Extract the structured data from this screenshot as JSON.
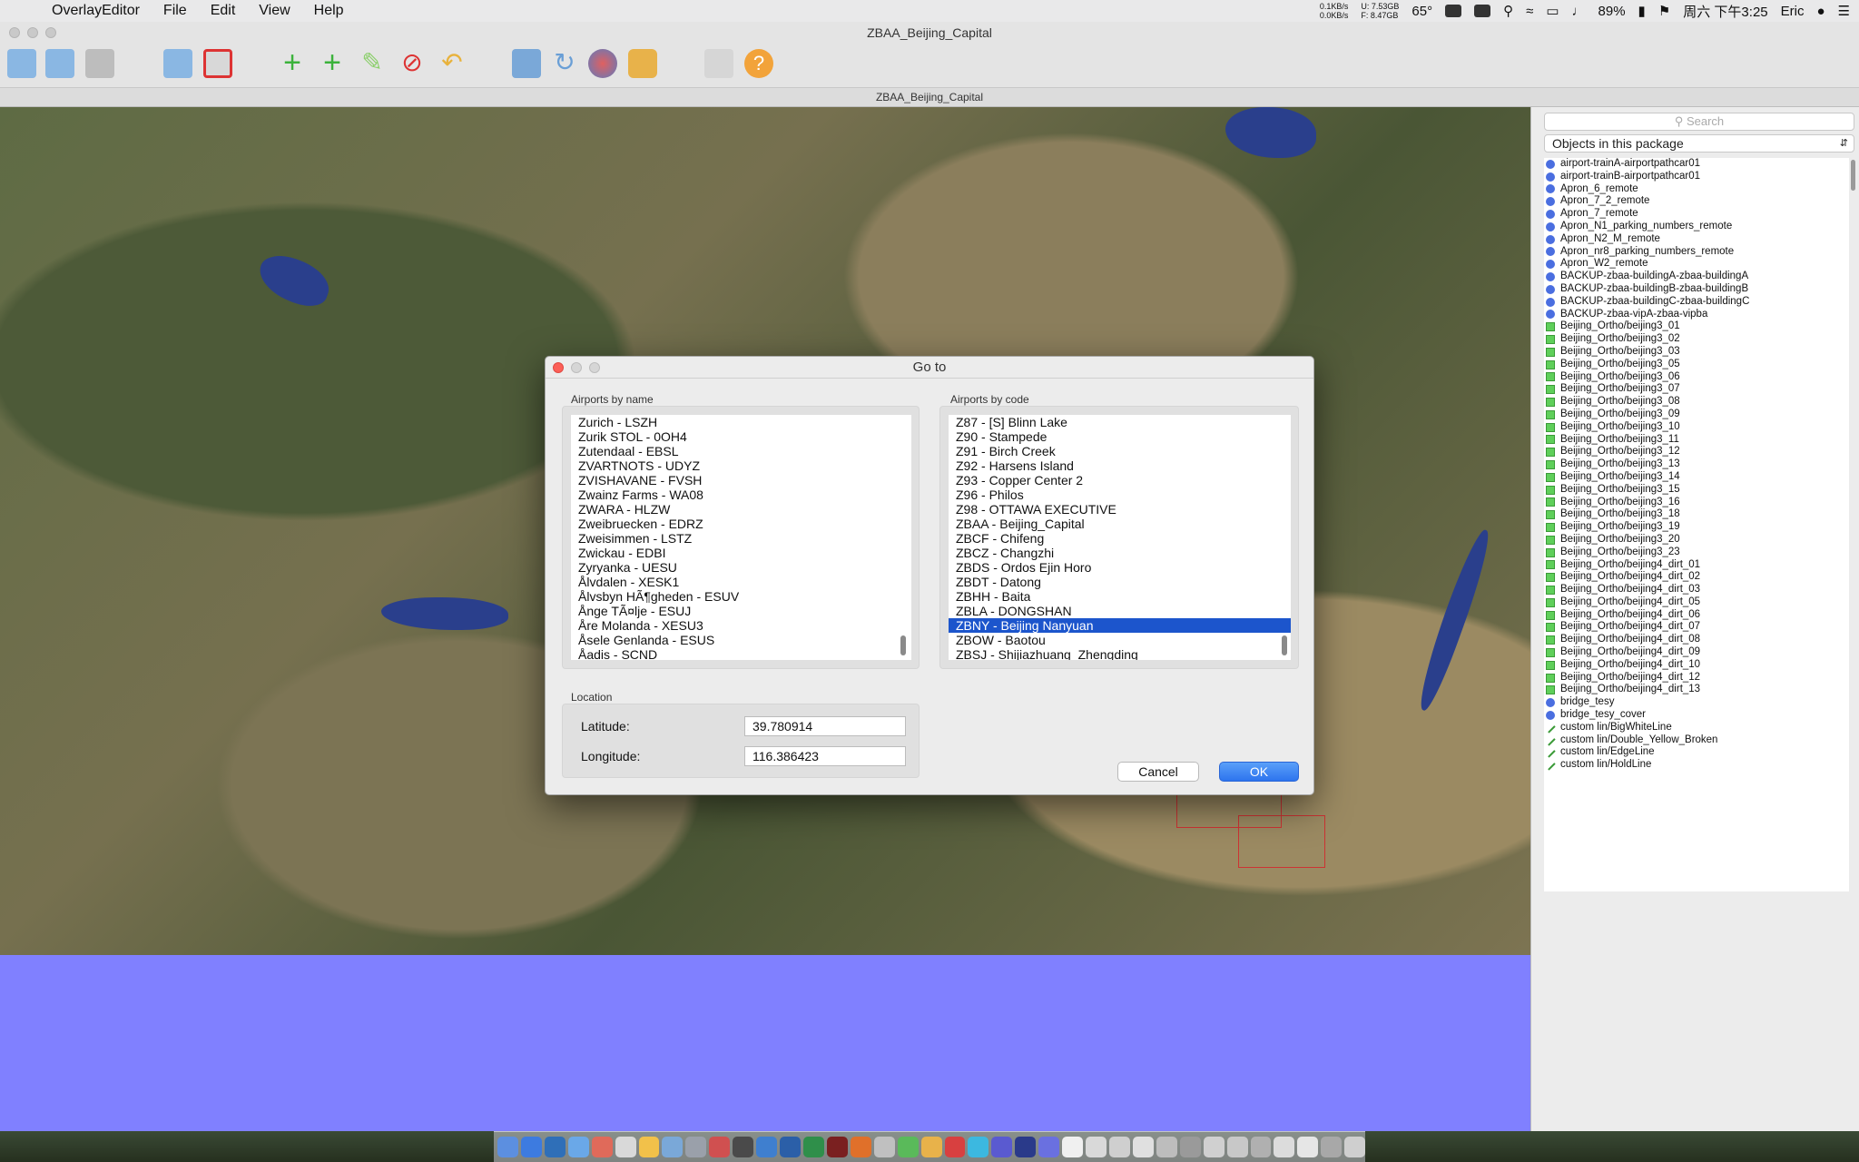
{
  "menubar": {
    "app_name": "OverlayEditor",
    "menus": [
      "File",
      "Edit",
      "View",
      "Help"
    ],
    "status": {
      "net_up": "0.1KB/s",
      "net_down": "0.0KB/s",
      "mem_used": "U: 7.53GB",
      "mem_free": "F: 8.47GB",
      "temp": "65°",
      "battery": "89%",
      "datetime": "周六 下午3:25",
      "user": "Eric"
    }
  },
  "window": {
    "title": "ZBAA_Beijing_Capital",
    "document_title": "ZBAA_Beijing_Capital"
  },
  "panel": {
    "search_placeholder": "Search",
    "filter_selected": "Objects in this package",
    "objects": [
      {
        "name": "airport-trainA-airportpathcar01",
        "kind": "blue"
      },
      {
        "name": "airport-trainB-airportpathcar01",
        "kind": "blue"
      },
      {
        "name": "Apron_6_remote",
        "kind": "blue"
      },
      {
        "name": "Apron_7_2_remote",
        "kind": "blue"
      },
      {
        "name": "Apron_7_remote",
        "kind": "blue"
      },
      {
        "name": "Apron_N1_parking_numbers_remote",
        "kind": "blue"
      },
      {
        "name": "Apron_N2_M_remote",
        "kind": "blue"
      },
      {
        "name": "Apron_nr8_parking_numbers_remote",
        "kind": "blue"
      },
      {
        "name": "Apron_W2_remote",
        "kind": "blue"
      },
      {
        "name": "BACKUP-zbaa-buildingA-zbaa-buildingA",
        "kind": "blue"
      },
      {
        "name": "BACKUP-zbaa-buildingB-zbaa-buildingB",
        "kind": "blue"
      },
      {
        "name": "BACKUP-zbaa-buildingC-zbaa-buildingC",
        "kind": "blue"
      },
      {
        "name": "BACKUP-zbaa-vipA-zbaa-vipba",
        "kind": "blue"
      },
      {
        "name": "Beijing_Ortho/beijing3_01",
        "kind": "green"
      },
      {
        "name": "Beijing_Ortho/beijing3_02",
        "kind": "green"
      },
      {
        "name": "Beijing_Ortho/beijing3_03",
        "kind": "green"
      },
      {
        "name": "Beijing_Ortho/beijing3_05",
        "kind": "green"
      },
      {
        "name": "Beijing_Ortho/beijing3_06",
        "kind": "green"
      },
      {
        "name": "Beijing_Ortho/beijing3_07",
        "kind": "green"
      },
      {
        "name": "Beijing_Ortho/beijing3_08",
        "kind": "green"
      },
      {
        "name": "Beijing_Ortho/beijing3_09",
        "kind": "green"
      },
      {
        "name": "Beijing_Ortho/beijing3_10",
        "kind": "green"
      },
      {
        "name": "Beijing_Ortho/beijing3_11",
        "kind": "green"
      },
      {
        "name": "Beijing_Ortho/beijing3_12",
        "kind": "green"
      },
      {
        "name": "Beijing_Ortho/beijing3_13",
        "kind": "green"
      },
      {
        "name": "Beijing_Ortho/beijing3_14",
        "kind": "green"
      },
      {
        "name": "Beijing_Ortho/beijing3_15",
        "kind": "green"
      },
      {
        "name": "Beijing_Ortho/beijing3_16",
        "kind": "green"
      },
      {
        "name": "Beijing_Ortho/beijing3_18",
        "kind": "green"
      },
      {
        "name": "Beijing_Ortho/beijing3_19",
        "kind": "green"
      },
      {
        "name": "Beijing_Ortho/beijing3_20",
        "kind": "green"
      },
      {
        "name": "Beijing_Ortho/beijing3_23",
        "kind": "green"
      },
      {
        "name": "Beijing_Ortho/beijing4_dirt_01",
        "kind": "green"
      },
      {
        "name": "Beijing_Ortho/beijing4_dirt_02",
        "kind": "green"
      },
      {
        "name": "Beijing_Ortho/beijing4_dirt_03",
        "kind": "green"
      },
      {
        "name": "Beijing_Ortho/beijing4_dirt_05",
        "kind": "green"
      },
      {
        "name": "Beijing_Ortho/beijing4_dirt_06",
        "kind": "green"
      },
      {
        "name": "Beijing_Ortho/beijing4_dirt_07",
        "kind": "green"
      },
      {
        "name": "Beijing_Ortho/beijing4_dirt_08",
        "kind": "green"
      },
      {
        "name": "Beijing_Ortho/beijing4_dirt_09",
        "kind": "green"
      },
      {
        "name": "Beijing_Ortho/beijing4_dirt_10",
        "kind": "green"
      },
      {
        "name": "Beijing_Ortho/beijing4_dirt_12",
        "kind": "green"
      },
      {
        "name": "Beijing_Ortho/beijing4_dirt_13",
        "kind": "green"
      },
      {
        "name": "bridge_tesy",
        "kind": "blue"
      },
      {
        "name": "bridge_tesy_cover",
        "kind": "blue"
      },
      {
        "name": "custom lin/BigWhiteLine",
        "kind": "line"
      },
      {
        "name": "custom lin/Double_Yellow_Broken",
        "kind": "line"
      },
      {
        "name": "custom lin/EdgeLine",
        "kind": "line"
      },
      {
        "name": "custom lin/HoldLine",
        "kind": "line"
      }
    ]
  },
  "dialog": {
    "title": "Go to",
    "by_name_label": "Airports by name",
    "by_code_label": "Airports by code",
    "by_name": [
      "Zurich - LSZH",
      "Zurik STOL - 0OH4",
      "Zutendaal - EBSL",
      "ZVARTNOTS - UDYZ",
      "ZVISHAVANE - FVSH",
      "Zwainz Farms - WA08",
      "ZWARA - HLZW",
      "Zweibruecken - EDRZ",
      "Zweisimmen - LSTZ",
      "Zwickau - EDBI",
      "Zyryanka - UESU",
      "Ålvdalen - XESK1",
      "Ålvsbyn HÃ¶gheden - ESUV",
      "Ånge TÃ¤lje - ESUJ",
      "Åre Molanda - XESU3",
      "Åsele Genlanda - ESUS",
      "Åadis - SCND"
    ],
    "by_code": [
      "Z87 - [S] Blinn Lake",
      "Z90 - Stampede",
      "Z91 - Birch Creek",
      "Z92 - Harsens Island",
      "Z93 - Copper Center 2",
      "Z96 - Philos",
      "Z98 - OTTAWA EXECUTIVE",
      "ZBAA - Beijing_Capital",
      "ZBCF - Chifeng",
      "ZBCZ - Changzhi",
      "ZBDS - Ordos Ejin Horo",
      "ZBDT - Datong",
      "ZBHH - Baita",
      "ZBLA - DONGSHAN",
      "ZBNY - Beijing Nanyuan",
      "ZBOW - Baotou",
      "ZBSJ - Shijiazhuang_Zhengding"
    ],
    "selected_code": "ZBNY - Beijing Nanyuan",
    "location_label": "Location",
    "latitude_label": "Latitude:",
    "latitude_value": "39.780914",
    "longitude_label": "Longitude:",
    "longitude_value": "116.386423",
    "cancel_label": "Cancel",
    "ok_label": "OK"
  },
  "colors": {
    "selection": "#1c55cc",
    "lake": "#2a3f8c",
    "unloaded_area": "#8080ff",
    "ok_button": "#2d74ee"
  }
}
